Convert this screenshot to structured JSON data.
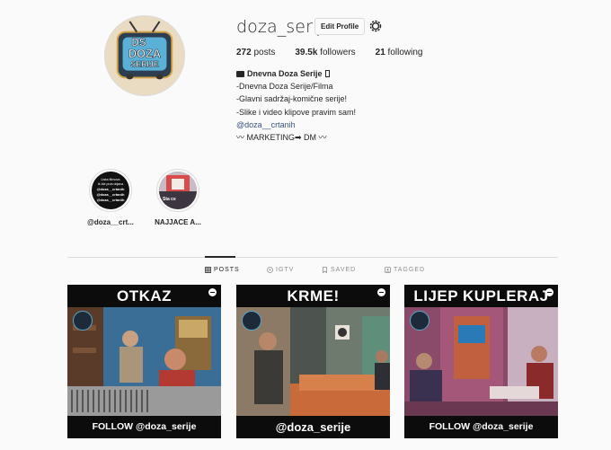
{
  "profile": {
    "username": "doza_serije",
    "edit_label": "Edit Profile",
    "avatar_text_top": "DS",
    "avatar_text_main": "DOZA",
    "avatar_text_sub": "SERIJE",
    "stats": {
      "posts_count": "272",
      "posts_label": " posts",
      "followers_count": "39.5k",
      "followers_label": " followers",
      "following_count": "21",
      "following_label": " following"
    },
    "bio": {
      "name": "Dnevna Doza Serije",
      "line1": "-Dnevna Doza Serije/Filma",
      "line2": "-Glavni sadržaj-komične serije!",
      "line3": "-Slike i video klipove pravim sam!",
      "mention": "@doza__crtanih",
      "line5": "〰 MARKETING➡ DM 〰"
    }
  },
  "highlights": [
    {
      "label": "@doza__crt...",
      "cover_text_1": "Lista filmova",
      "cover_text_2": "tk ide prva objava",
      "cover_text_3": "@doza__crtanih",
      "cover_text_4": "@doza__crtanih",
      "cover_text_5": "@doza__crtanih"
    },
    {
      "label": "NAJJACE A...",
      "cover_text_1": "Sta ce"
    }
  ],
  "tabs": [
    {
      "label": "POSTS",
      "icon": "grid-icon",
      "active": true
    },
    {
      "label": "IGTV",
      "icon": "igtv-icon",
      "active": false
    },
    {
      "label": "SAVED",
      "icon": "bookmark-icon",
      "active": false
    },
    {
      "label": "TAGGED",
      "icon": "tag-icon",
      "active": false
    }
  ],
  "posts": [
    {
      "title": "OTKAZ",
      "footer": "FOLLOW @doza_serije"
    },
    {
      "title": "KRME!",
      "footer": "@doza_serije"
    },
    {
      "title": "LIJEP KUPLERAJ",
      "footer": "FOLLOW @doza_serije"
    }
  ],
  "colors": {
    "background": "#fafafa",
    "text": "#262626",
    "muted": "#8e8e8e",
    "link": "#385185",
    "border": "#dbdbdb"
  }
}
